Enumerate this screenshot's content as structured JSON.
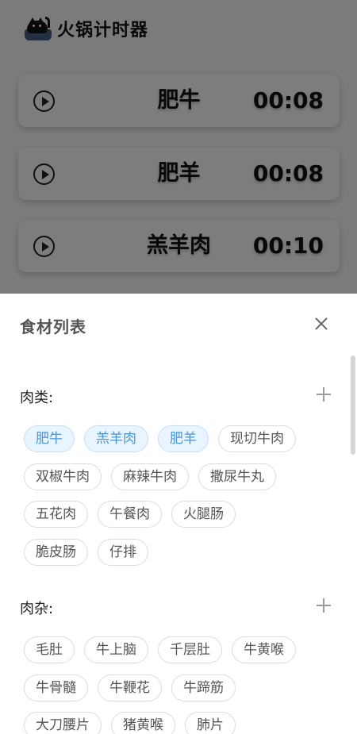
{
  "app": {
    "title": "火锅计时器",
    "timers": [
      {
        "name": "肥牛",
        "time": "00:08"
      },
      {
        "name": "肥羊",
        "time": "00:08"
      },
      {
        "name": "羔羊肉",
        "time": "00:10"
      }
    ]
  },
  "sheet": {
    "title": "食材列表",
    "sections": [
      {
        "label": "肉类:",
        "rows": [
          [
            {
              "text": "肥牛",
              "selected": true
            },
            {
              "text": "羔羊肉",
              "selected": true
            },
            {
              "text": "肥羊",
              "selected": true
            },
            {
              "text": "现切牛肉",
              "selected": false
            }
          ],
          [
            {
              "text": "双椒牛肉",
              "selected": false
            },
            {
              "text": "麻辣牛肉",
              "selected": false
            },
            {
              "text": "撒尿牛丸",
              "selected": false
            }
          ],
          [
            {
              "text": "五花肉",
              "selected": false
            },
            {
              "text": "午餐肉",
              "selected": false
            },
            {
              "text": "火腿肠",
              "selected": false
            }
          ],
          [
            {
              "text": "脆皮肠",
              "selected": false
            },
            {
              "text": "仔排",
              "selected": false
            }
          ]
        ]
      },
      {
        "label": "肉杂:",
        "rows": [
          [
            {
              "text": "毛肚",
              "selected": false
            },
            {
              "text": "牛上脑",
              "selected": false
            },
            {
              "text": "千层肚",
              "selected": false
            },
            {
              "text": "牛黄喉",
              "selected": false
            }
          ],
          [
            {
              "text": "牛骨髓",
              "selected": false
            },
            {
              "text": "牛鞭花",
              "selected": false
            },
            {
              "text": "牛蹄筋",
              "selected": false
            }
          ],
          [
            {
              "text": "大刀腰片",
              "selected": false
            },
            {
              "text": "猪黄喉",
              "selected": false
            },
            {
              "text": "肺片",
              "selected": false
            }
          ]
        ]
      }
    ]
  },
  "colors": {
    "selected_chip_bg": "#e8f4ff",
    "selected_chip_text": "#4a97d0",
    "overlay": "rgba(0,0,0,0.5)"
  }
}
